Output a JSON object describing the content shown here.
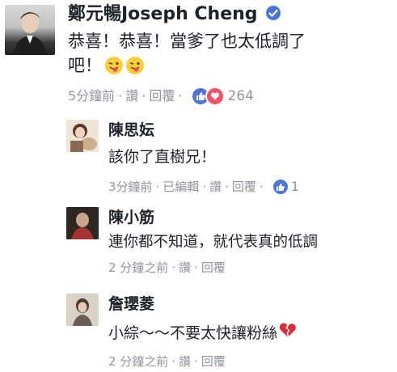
{
  "comments": [
    {
      "author": "鄭元暢Joseph Cheng",
      "verified": true,
      "text_line1": "恭喜！恭喜！當爹了也太低調了",
      "text_line2": "吧！",
      "emoji": "winking-tongue-emoji",
      "time": "5分鐘前",
      "like": "讚",
      "reply": "回覆",
      "reaction_count": "264"
    },
    {
      "author": "陳思妘",
      "text": "該你了直樹兄！",
      "time": "3分鐘前",
      "edited": "已編輯",
      "like": "讚",
      "reply": "回覆",
      "reaction_count": "1"
    },
    {
      "author": "陳小筋",
      "text": "連你都不知道，就代表真的低調",
      "time": "2 分鐘之前",
      "like": "讚",
      "reply": "回覆"
    },
    {
      "author": "詹瓔菱",
      "text": "小綜～～不要太快讓粉絲",
      "time": "2 分鐘之前",
      "like": "讚",
      "reply": "回覆"
    }
  ],
  "colors": {
    "text": "#1d2129",
    "meta": "#90949c",
    "like_blue": "#4a76d8",
    "love_red": "#f1536a",
    "verified_blue": "#4a76d8"
  }
}
